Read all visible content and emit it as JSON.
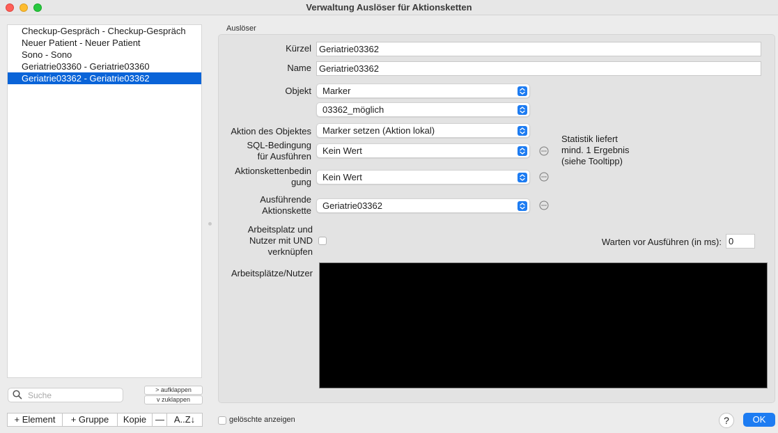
{
  "window": {
    "title": "Verwaltung Auslöser für Aktionsketten"
  },
  "list": {
    "items": [
      "Checkup-Gespräch - Checkup-Gespräch",
      "Neuer Patient - Neuer Patient",
      "Sono - Sono",
      "Geriatrie03360 - Geriatrie03360",
      "Geriatrie03362 - Geriatrie03362"
    ],
    "selected_index": 4
  },
  "search": {
    "placeholder": "Suche"
  },
  "tree_buttons": {
    "expand": "> aufklappen",
    "collapse": "v  zuklappen"
  },
  "bottom_bar": {
    "add_element": "+ Element",
    "add_group": "+ Gruppe",
    "copy": "Kopie",
    "remove": "—",
    "sort": "A..Z↓"
  },
  "show_deleted": {
    "label": "gelöschte anzeigen",
    "checked": false
  },
  "help": "?",
  "ok": "OK",
  "form": {
    "group_title": "Auslöser",
    "kuerzel_label": "Kürzel",
    "kuerzel_value": "Geriatrie03362",
    "name_label": "Name",
    "name_value": "Geriatrie03362",
    "objekt_label": "Objekt",
    "objekt_value": "Marker",
    "objekt_sub_value": "03362_möglich",
    "aktion_label": "Aktion des Objektes",
    "aktion_value": "Marker setzen (Aktion lokal)",
    "sql_label_1": "SQL-Bedingung",
    "sql_label_2": "für Ausführen",
    "sql_value": "Kein Wert",
    "stat_1": "Statistik liefert",
    "stat_2": "mind. 1 Ergebnis",
    "stat_3": "(siehe Tooltipp)",
    "akb_label_1": "Aktionskettenbedin",
    "akb_label_2": "gung",
    "akb_value": "Kein Wert",
    "ausf_label_1": "Ausführende",
    "ausf_label_2": "Aktionskette",
    "ausf_value": "Geriatrie03362",
    "und_label_1": "Arbeitsplatz und",
    "und_label_2": "Nutzer mit UND",
    "und_label_3": "verknüpfen",
    "und_checked": false,
    "warten_label": "Warten vor Ausführen (in ms):",
    "warten_value": "0",
    "arbeitsplaetze_label": "Arbeitsplätze/Nutzer"
  }
}
